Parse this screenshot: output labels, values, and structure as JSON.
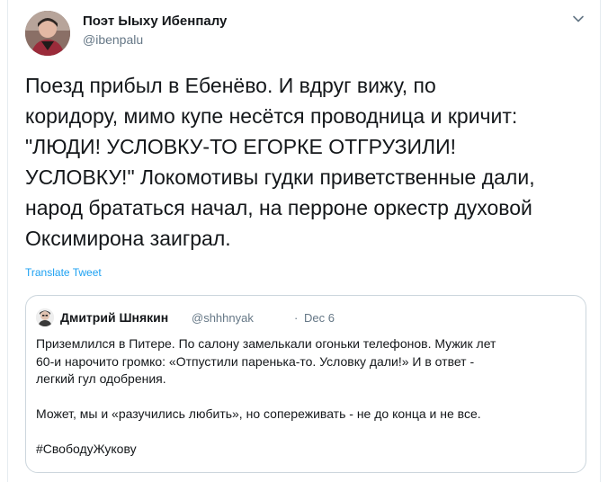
{
  "tweet": {
    "author_name": "Поэт Ыыху Ибенпалу",
    "author_handle": "@ibenpalu",
    "text": "Поезд прибыл в Ебенёво. И вдруг вижу, по\nкоридору, мимо купе несётся проводница и кричит:\n\"ЛЮДИ! УСЛОВКУ-ТО ЕГОРКЕ ОТГРУЗИЛИ!\nУСЛОВКУ!\" Локомотивы гудки приветственные дали,\nнарод брататься начал, на перроне оркестр духовой\nОксимирона заиграл.",
    "translate_label": "Translate Tweet",
    "more_icon": "chevron-down-icon"
  },
  "quoted": {
    "author_name": "Дмитрий Шнякин",
    "author_handle": "@shhhnyak",
    "separator": "·",
    "date": "Dec 6",
    "paragraphs": [
      "Приземлился в Питере. По салону замелькали огоньки телефонов. Мужик лет\n60-и нарочито громко: «Отпустили паренька-то. Условку дали!» И в ответ -\nлегкий гул одобрения.",
      "Может, мы и «разучились любить», но сопереживать - не до конца и не все."
    ],
    "hashtag": "#СвободуЖукову"
  },
  "colors": {
    "text": "#14171a",
    "secondary": "#657786",
    "link": "#1da1f2",
    "border": "#ccd6dd"
  }
}
